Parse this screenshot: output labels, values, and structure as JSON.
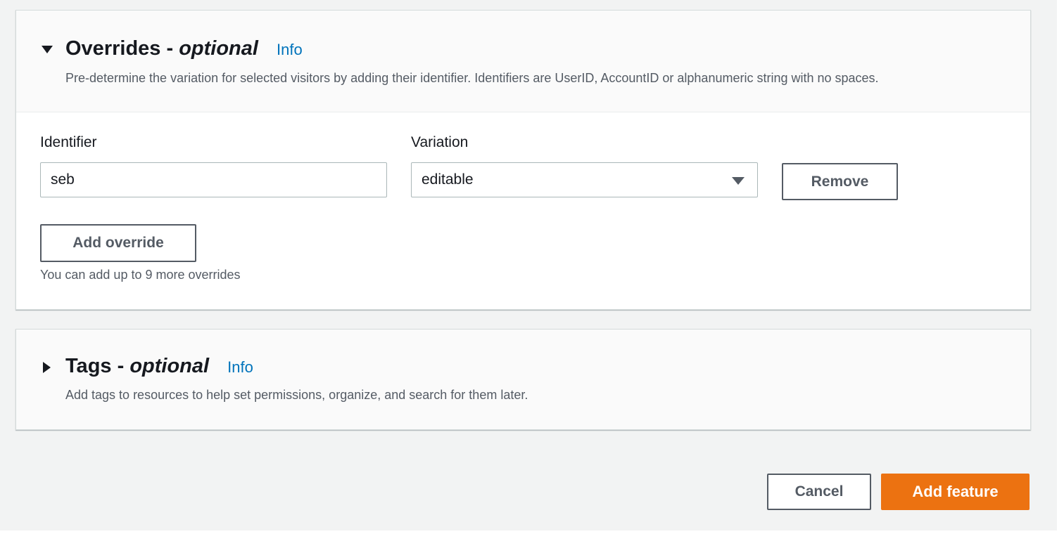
{
  "overrides": {
    "title": "Overrides -",
    "title_optional": "optional",
    "info": "Info",
    "description": "Pre-determine the variation for selected visitors by adding their identifier. Identifiers are UserID, AccountID or alphanumeric string with no spaces.",
    "identifier_label": "Identifier",
    "identifier_value": "seb",
    "variation_label": "Variation",
    "variation_value": "editable",
    "remove_label": "Remove",
    "add_override_label": "Add override",
    "hint": "You can add up to 9 more overrides"
  },
  "tags": {
    "title": "Tags -",
    "title_optional": "optional",
    "info": "Info",
    "description": "Add tags to resources to help set permissions, organize, and search for them later."
  },
  "footer": {
    "cancel_label": "Cancel",
    "add_feature_label": "Add feature"
  },
  "colors": {
    "primary": "#ec7211",
    "link": "#0073bb"
  }
}
